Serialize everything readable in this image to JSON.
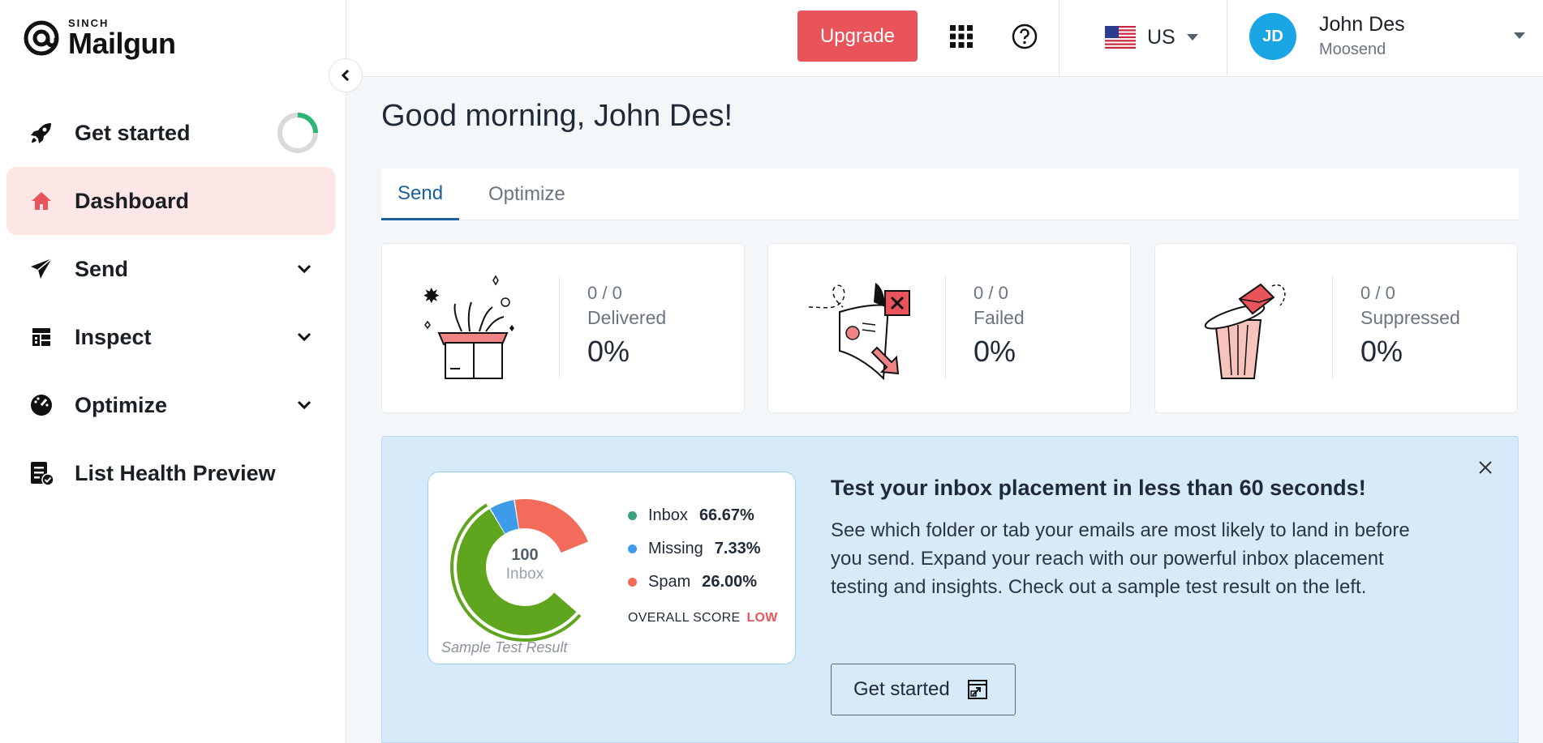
{
  "brand": {
    "sinch": "SINCH",
    "name": "Mailgun"
  },
  "sidebar": {
    "items": [
      {
        "label": "Get started",
        "icon": "rocket-icon"
      },
      {
        "label": "Dashboard",
        "icon": "home-icon",
        "active": true
      },
      {
        "label": "Send",
        "icon": "paper-plane-icon"
      },
      {
        "label": "Inspect",
        "icon": "inspect-grid-icon"
      },
      {
        "label": "Optimize",
        "icon": "gauge-icon"
      },
      {
        "label": "List Health Preview",
        "icon": "list-check-icon"
      }
    ],
    "get_started_progress": 0.25
  },
  "topbar": {
    "upgrade_label": "Upgrade",
    "region_label": "US",
    "user": {
      "initials": "JD",
      "name": "John Des",
      "org": "Moosend"
    }
  },
  "main": {
    "greeting": "Good morning, John Des!",
    "tabs": [
      {
        "label": "Send",
        "active": true
      },
      {
        "label": "Optimize"
      }
    ],
    "stats": [
      {
        "ratio": "0 / 0",
        "name": "Delivered",
        "percent": "0%"
      },
      {
        "ratio": "0 / 0",
        "name": "Failed",
        "percent": "0%"
      },
      {
        "ratio": "0 / 0",
        "name": "Suppressed",
        "percent": "0%"
      }
    ]
  },
  "promo": {
    "title": "Test your inbox placement in less than 60 seconds!",
    "body": "See which folder or tab your emails are most likely to land in before you send. Expand your reach with our powerful inbox placement testing and insights. Check out a sample test result on the left.",
    "button_label": "Get started",
    "sample": {
      "center_number": "100",
      "center_label": "Inbox",
      "legend": [
        {
          "label": "Inbox",
          "value": "66.67%",
          "color": "#5fa51e"
        },
        {
          "label": "Missing",
          "value": "7.33%",
          "color": "#3d9be9"
        },
        {
          "label": "Spam",
          "value": "26.00%",
          "color": "#f26b5b"
        }
      ],
      "legend_dot_colors": [
        "#3aa17e",
        "#3d9be9",
        "#f26b5b"
      ],
      "overall_label": "OVERALL SCORE",
      "overall_value": "LOW",
      "caption": "Sample Test Result"
    }
  },
  "colors": {
    "accent": "#e9535a",
    "active_nav_bg": "#fde6e6",
    "tab_active": "#1c5f9c",
    "avatar": "#1aa5e4",
    "promo_bg": "#d7eaf9"
  }
}
